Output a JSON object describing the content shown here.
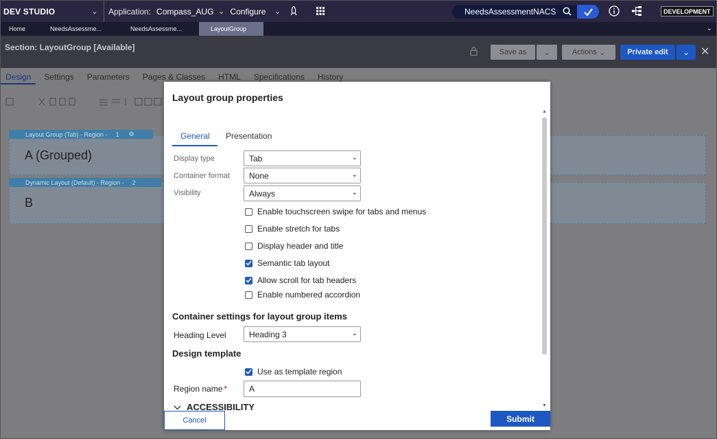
{
  "topbar": {
    "brand": "DEV STUDIO",
    "app_label": "Application:",
    "app_name": "Compass_AUG",
    "configure": "Configure",
    "search_value": "NeedsAssessmentNACS",
    "env_badge": "DEVELOPMENT"
  },
  "doc_tabs": [
    {
      "label": "Home",
      "active": false
    },
    {
      "label": "NeedsAssessme...",
      "active": false
    },
    {
      "label": "NeedsAssessme...",
      "active": false
    },
    {
      "label": "LayoutGroup",
      "active": true
    }
  ],
  "section": {
    "title": "Section: LayoutGroup [Available]",
    "save_as": "Save as",
    "actions": "Actions",
    "private_edit": "Private edit"
  },
  "rule_tabs": [
    "Design",
    "Settings",
    "Parameters",
    "Pages & Classes",
    "HTML",
    "Specifications",
    "History"
  ],
  "regions": [
    {
      "bar_label": "Layout Group (Tab) - Region -",
      "bar_num": "1",
      "text": "A (Grouped)"
    },
    {
      "bar_label": "Dynamic Layout (Default) - Region -",
      "bar_num": "2",
      "text": "B"
    }
  ],
  "modal": {
    "title": "Layout group properties",
    "tabs": [
      "General",
      "Presentation"
    ],
    "fields": {
      "display_type": {
        "label": "Display type",
        "value": "Tab"
      },
      "container_format": {
        "label": "Container format",
        "value": "None"
      },
      "visibility": {
        "label": "Visibility",
        "value": "Always"
      }
    },
    "checkboxes": [
      {
        "label": "Enable touchscreen swipe for tabs and menus",
        "checked": false
      },
      {
        "label": "Enable stretch for tabs",
        "checked": false
      },
      {
        "label": "Display header and title",
        "checked": false
      },
      {
        "label": "Semantic tab layout",
        "checked": true
      },
      {
        "label": "Allow scroll for tab headers",
        "checked": true
      },
      {
        "label": "Enable numbered accordion",
        "checked": false
      }
    ],
    "container_settings_heading": "Container settings for layout group items",
    "heading_level": {
      "label": "Heading Level",
      "value": "Heading 3"
    },
    "design_template_heading": "Design template",
    "use_as_template": {
      "label": "Use as template region",
      "checked": true
    },
    "region_name": {
      "label": "Region name",
      "required_mark": "*",
      "value": "A"
    },
    "accessibility_heading": "ACCESSIBILITY",
    "cancel": "Cancel",
    "submit": "Submit"
  },
  "colors": {
    "accent": "#1d58c2",
    "topbar_bg": "#2a2540"
  }
}
